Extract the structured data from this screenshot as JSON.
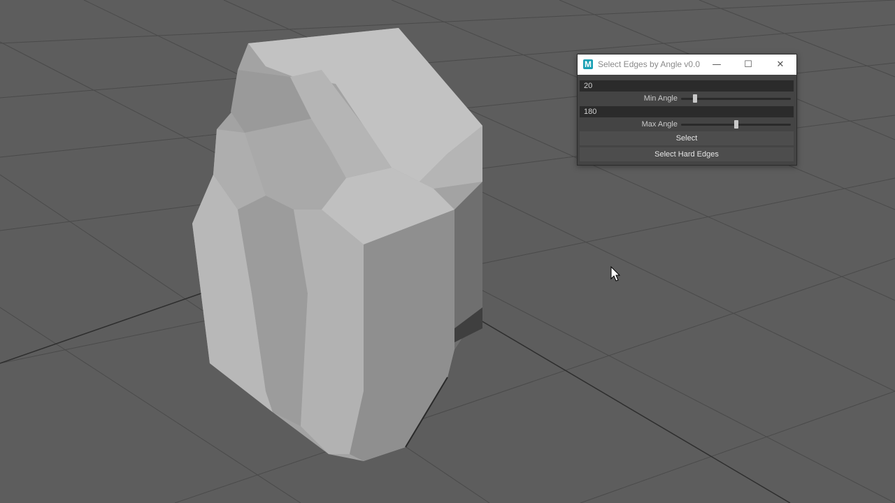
{
  "window": {
    "title": "Select Edges by Angle v0.0",
    "app_icon_letter": "M",
    "icon_color": "#1aa0b4",
    "controls": {
      "minimize": "—",
      "maximize": "☐",
      "close": "✕"
    }
  },
  "fields": {
    "min_angle_value": "20",
    "min_angle_label": "Min Angle",
    "max_angle_value": "180",
    "max_angle_label": "Max Angle"
  },
  "sliders": {
    "min_level": 0.11,
    "max_level": 0.5
  },
  "buttons": {
    "select": "Select",
    "select_hard_edges": "Select Hard Edges"
  },
  "viewport": {
    "background_color": "#5d5d5d",
    "grid_color": "#454545",
    "mesh_color": "#a8a8a8"
  }
}
